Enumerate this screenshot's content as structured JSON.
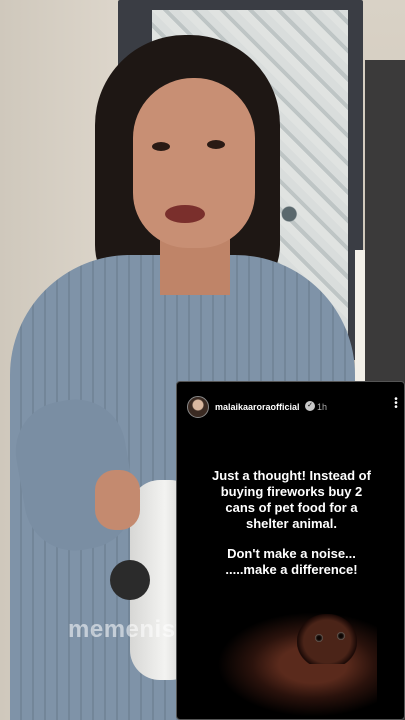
{
  "video": {
    "watermark": "memenist"
  },
  "story": {
    "username": "malaikaaroraofficial",
    "time": "1h",
    "verified_icon": "verified-badge-icon",
    "more_icon": "more-vertical-icon",
    "lines": [
      "Just a thought! Instead of",
      "buying fireworks buy 2",
      "cans of pet food for a",
      "shelter animal.",
      "Don't make a noise...",
      ".....make a difference!"
    ]
  },
  "colors": {
    "story_bg": "#000000",
    "story_text": "#ffffff",
    "shirt": "#7f93a8"
  }
}
